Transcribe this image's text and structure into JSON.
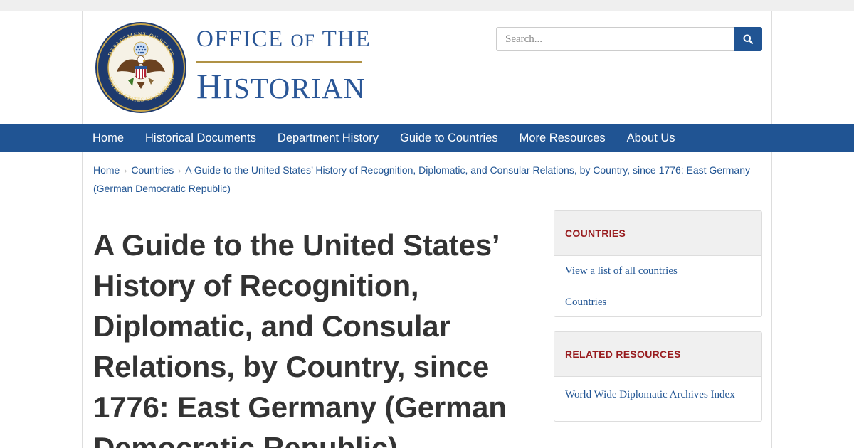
{
  "brand": {
    "line1_a": "Office",
    "line1_of": "of",
    "line1_b": "the",
    "line2_first": "H",
    "line2_rest": "istorian",
    "seal_text_top": "DEPARTMENT OF STATE",
    "seal_text_bottom": "UNITED STATES OF AMERICA"
  },
  "search": {
    "placeholder": "Search...",
    "button_icon": "search-icon"
  },
  "nav": {
    "items": [
      "Home",
      "Historical Documents",
      "Department History",
      "Guide to Countries",
      "More Resources",
      "About Us"
    ]
  },
  "breadcrumb": {
    "items": [
      "Home",
      "Countries",
      "A Guide to the United States’ History of Recognition, Diplomatic, and Consular Relations, by Country, since 1776: East Germany (German Democratic Republic)"
    ]
  },
  "page": {
    "title": "A Guide to the United States’ History of Recognition, Diplomatic, and Consular Relations, by Country, since 1776: East Germany (German Democratic Republic)"
  },
  "sidebar": {
    "countries": {
      "heading": "COUNTRIES",
      "links": [
        "View a list of all countries",
        "Countries"
      ]
    },
    "related": {
      "heading": "RELATED RESOURCES",
      "links": [
        "World Wide Diplomatic Archives Index"
      ]
    }
  },
  "colors": {
    "primary": "#205493",
    "accent_red": "#981b1e",
    "gold": "#b09245"
  }
}
